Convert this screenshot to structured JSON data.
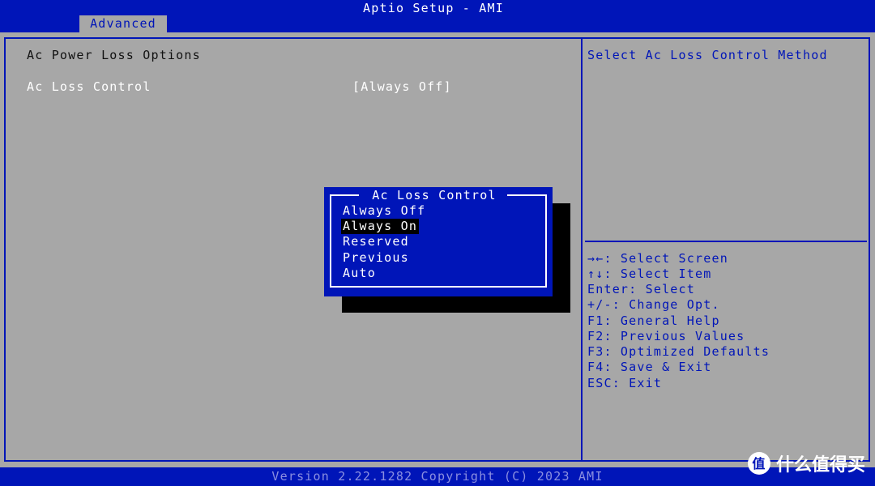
{
  "app": {
    "title": "Aptio Setup - AMI"
  },
  "tabs": [
    {
      "label": "Advanced",
      "active": true
    }
  ],
  "main": {
    "section_title": "Ac Power Loss Options",
    "settings": [
      {
        "label": "Ac Loss Control",
        "value": "[Always Off]"
      }
    ]
  },
  "help": {
    "description": "Select Ac Loss Control Method",
    "keys": [
      {
        "icon": "arrows-left-right-icon",
        "text": "→←: Select Screen"
      },
      {
        "icon": "arrows-up-down-icon",
        "text": "↑↓: Select Item"
      },
      {
        "text": "Enter: Select"
      },
      {
        "text": "+/-: Change Opt."
      },
      {
        "text": "F1: General Help"
      },
      {
        "text": "F2: Previous Values"
      },
      {
        "text": "F3: Optimized Defaults"
      },
      {
        "text": "F4: Save & Exit"
      },
      {
        "text": "ESC: Exit"
      }
    ]
  },
  "popup": {
    "title": "Ac Loss Control",
    "options": [
      {
        "label": "Always Off",
        "selected": false
      },
      {
        "label": "Always On",
        "selected": true
      },
      {
        "label": "Reserved",
        "selected": false
      },
      {
        "label": "Previous",
        "selected": false
      },
      {
        "label": "Auto",
        "selected": false
      }
    ]
  },
  "footer": {
    "text": "Version 2.22.1282 Copyright (C) 2023 AMI"
  },
  "watermark": {
    "logo_text": "值",
    "text": "什么值得买"
  },
  "colors": {
    "bios_blue": "#0015b8",
    "panel_gray": "#a7a7a7",
    "highlight_black": "#000000",
    "text_white": "#ffffff"
  }
}
